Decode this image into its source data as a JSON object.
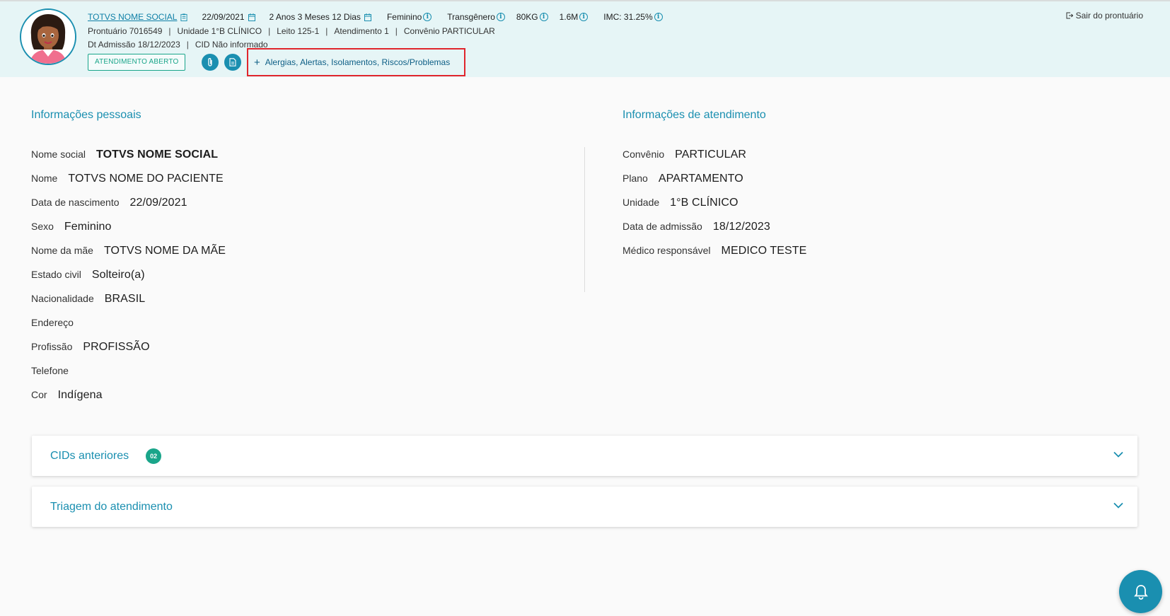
{
  "header": {
    "patient_name": "TOTVS NOME SOCIAL",
    "birth_date": "22/09/2021",
    "age": "2 Anos 3 Meses 12 Dias",
    "sex": "Feminino",
    "gender": "Transgênero",
    "weight": "80KG",
    "height": "1.6M",
    "bmi": "IMC: 31.25%",
    "prontuario": "Prontuário 7016549",
    "unidade": "Unidade 1°B CLÍNICO",
    "leito": "Leito 125-1",
    "atendimento": "Atendimento 1",
    "convenio": "Convênio PARTICULAR",
    "admissao": "Dt Admissão 18/12/2023",
    "cid": "CID Não informado",
    "separator": "|",
    "status": "ATENDIMENTO ABERTO",
    "alerts_label": "Alergias, Alertas, Isolamentos, Riscos/Problemas",
    "logout_label": "Sair do prontuário"
  },
  "personal": {
    "title": "Informações pessoais",
    "fields": [
      {
        "label": "Nome social",
        "value": "TOTVS NOME SOCIAL"
      },
      {
        "label": "Nome",
        "value": "TOTVS NOME DO PACIENTE"
      },
      {
        "label": "Data de nascimento",
        "value": "22/09/2021"
      },
      {
        "label": "Sexo",
        "value": "Feminino"
      },
      {
        "label": "Nome da mãe",
        "value": "TOTVS NOME DA MÃE"
      },
      {
        "label": "Estado civil",
        "value": "Solteiro(a)"
      },
      {
        "label": "Nacionalidade",
        "value": "BRASIL"
      },
      {
        "label": "Endereço",
        "value": ""
      },
      {
        "label": "Profissão",
        "value": "PROFISSÃO"
      },
      {
        "label": "Telefone",
        "value": ""
      },
      {
        "label": "Cor",
        "value": "Indígena"
      }
    ]
  },
  "attendance": {
    "title": "Informações de atendimento",
    "fields": [
      {
        "label": "Convênio",
        "value": "PARTICULAR"
      },
      {
        "label": "Plano",
        "value": "APARTAMENTO"
      },
      {
        "label": "Unidade",
        "value": "1°B CLÍNICO"
      },
      {
        "label": "Data de admissão",
        "value": "18/12/2023"
      },
      {
        "label": "Médico responsável",
        "value": "MEDICO TESTE"
      }
    ]
  },
  "accordions": {
    "cids": {
      "title": "CIDs anteriores",
      "badge": "02"
    },
    "triagem": {
      "title": "Triagem do atendimento"
    }
  },
  "colors": {
    "primary": "#1a8fb0",
    "success": "#1aa58a",
    "highlight": "#e0252c",
    "header_bg": "#e6f5f6"
  },
  "icons": [
    "clipboard-icon",
    "calendar-icon",
    "info-icon",
    "paperclip-icon",
    "document-icon",
    "plus-icon",
    "logout-icon",
    "chevron-down-icon",
    "bell-icon"
  ]
}
